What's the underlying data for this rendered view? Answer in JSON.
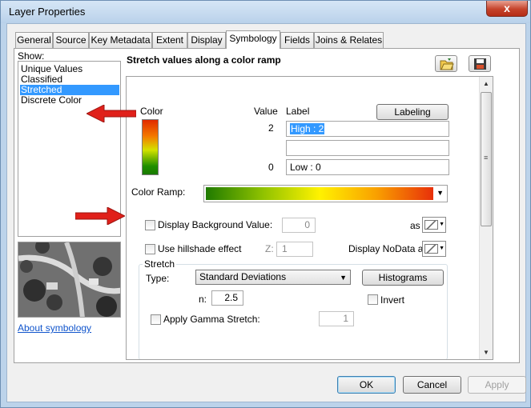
{
  "window": {
    "title": "Layer Properties",
    "close_symbol": "x"
  },
  "tabs": [
    {
      "label": "General"
    },
    {
      "label": "Source"
    },
    {
      "label": "Key Metadata"
    },
    {
      "label": "Extent"
    },
    {
      "label": "Display"
    },
    {
      "label": "Symbology"
    },
    {
      "label": "Fields"
    },
    {
      "label": "Join...s"
    }
  ],
  "tabs_fixed": {
    "joins": "Joins & Relates"
  },
  "show": {
    "label": "Show:",
    "items": [
      {
        "label": "Unique Values"
      },
      {
        "label": "Classified"
      },
      {
        "label": "Stretched",
        "selected": true
      },
      {
        "label": "Discrete Color"
      }
    ],
    "about_link": "About symbology"
  },
  "symbology": {
    "heading": "Stretch values along a color ramp",
    "import_icon": "open-folder-icon",
    "save_icon": "save-disk-icon",
    "color_header": "Color",
    "value_header": "Value",
    "label_header": "Label",
    "labeling_button": "Labeling",
    "high_value": "2",
    "high_label": "High : 2",
    "middle_label": "",
    "low_value": "0",
    "low_label": "Low : 0",
    "color_ramp_label": "Color Ramp:",
    "display_background_label": "Display Background Value:",
    "background_value": "0",
    "as_label_1": "as",
    "hillshade_label": "Use hillshade effect",
    "z_label": "Z:",
    "z_value": "1",
    "nodata_label": "Display NoData as",
    "stretch_group": "Stretch",
    "type_label": "Type:",
    "type_value": "Standard Deviations",
    "histograms_button": "Histograms",
    "n_label": "n:",
    "n_value": "2.5",
    "invert_label": "Invert",
    "gamma_label": "Apply Gamma Stretch:",
    "gamma_value": "1"
  },
  "footer": {
    "ok": "OK",
    "cancel": "Cancel",
    "apply": "Apply"
  },
  "colors": {
    "selection": "#3399ff",
    "arrow": "#e0201a",
    "link": "#1155cc"
  }
}
